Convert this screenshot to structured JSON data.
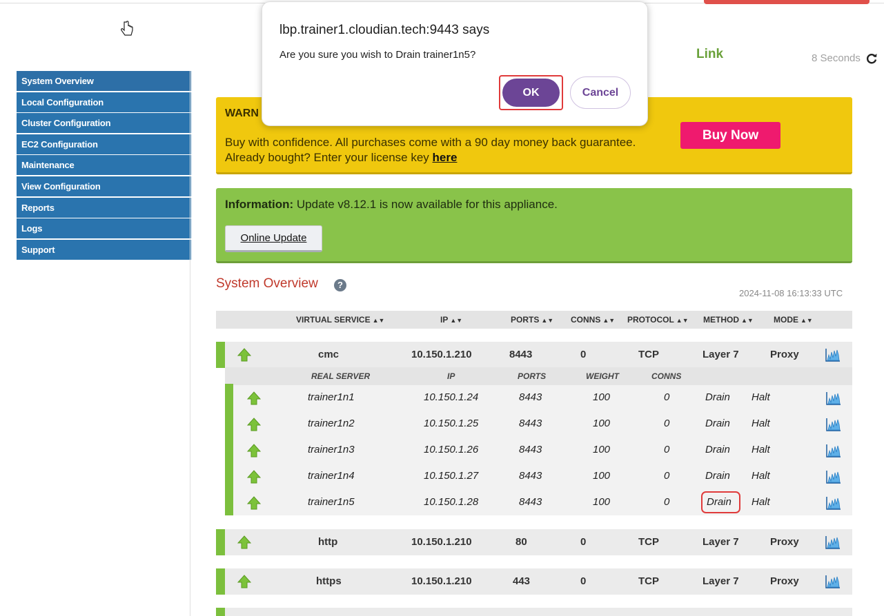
{
  "header": {
    "link_label": "Link",
    "refresh_text": "8 Seconds",
    "refresh_icon": "refresh-icon"
  },
  "sidebar": {
    "items": [
      {
        "label": "System Overview"
      },
      {
        "label": "Local Configuration"
      },
      {
        "label": "Cluster Configuration"
      },
      {
        "label": "EC2 Configuration"
      },
      {
        "label": "Maintenance"
      },
      {
        "label": "View Configuration"
      },
      {
        "label": "Reports"
      },
      {
        "label": "Logs"
      },
      {
        "label": "Support"
      }
    ]
  },
  "warning": {
    "title": "WARN",
    "line1": "Buy with confidence. All purchases come with a 90 day money back guarantee.",
    "line2_prefix": "Already bought? Enter your license key ",
    "line2_link": "here",
    "buy_label": "Buy Now"
  },
  "info": {
    "label": "Information:",
    "text": " Update v8.12.1 is now available for this appliance.",
    "button_label": "Online Update"
  },
  "overview": {
    "title": "System Overview",
    "help": "?",
    "timestamp": "2024-11-08 16:13:33 UTC",
    "columns": [
      "VIRTUAL SERVICE",
      "IP",
      "PORTS",
      "CONNS",
      "PROTOCOL",
      "METHOD",
      "MODE"
    ],
    "sort_glyph": "▲▼",
    "virtual_services": [
      {
        "name": "cmc",
        "ip": "10.150.1.210",
        "ports": "8443",
        "conns": "0",
        "protocol": "TCP",
        "method": "Layer 7",
        "mode": "Proxy"
      },
      {
        "name": "http",
        "ip": "10.150.1.210",
        "ports": "80",
        "conns": "0",
        "protocol": "TCP",
        "method": "Layer 7",
        "mode": "Proxy"
      },
      {
        "name": "https",
        "ip": "10.150.1.210",
        "ports": "443",
        "conns": "0",
        "protocol": "TCP",
        "method": "Layer 7",
        "mode": "Proxy"
      }
    ],
    "rs_columns": [
      "REAL SERVER",
      "IP",
      "PORTS",
      "WEIGHT",
      "CONNS"
    ],
    "real_servers": [
      {
        "name": "trainer1n1",
        "ip": "10.150.1.24",
        "ports": "8443",
        "weight": "100",
        "conns": "0",
        "drain": "Drain",
        "halt": "Halt"
      },
      {
        "name": "trainer1n2",
        "ip": "10.150.1.25",
        "ports": "8443",
        "weight": "100",
        "conns": "0",
        "drain": "Drain",
        "halt": "Halt"
      },
      {
        "name": "trainer1n3",
        "ip": "10.150.1.26",
        "ports": "8443",
        "weight": "100",
        "conns": "0",
        "drain": "Drain",
        "halt": "Halt"
      },
      {
        "name": "trainer1n4",
        "ip": "10.150.1.27",
        "ports": "8443",
        "weight": "100",
        "conns": "0",
        "drain": "Drain",
        "halt": "Halt"
      },
      {
        "name": "trainer1n5",
        "ip": "10.150.1.28",
        "ports": "8443",
        "weight": "100",
        "conns": "0",
        "drain": "Drain",
        "halt": "Halt"
      }
    ]
  },
  "dialog": {
    "title": "lbp.trainer1.cloudian.tech:9443 says",
    "message": "Are you sure you wish to Drain trainer1n5?",
    "ok_label": "OK",
    "cancel_label": "Cancel"
  },
  "colors": {
    "sidebar": "#2a74ae",
    "warning": "#f0c80e",
    "info": "#89c34a",
    "buy": "#ef1a6e",
    "status_bar": "#7cbf3d",
    "ok": "#6c4596",
    "highlight": "#e03a3a"
  }
}
